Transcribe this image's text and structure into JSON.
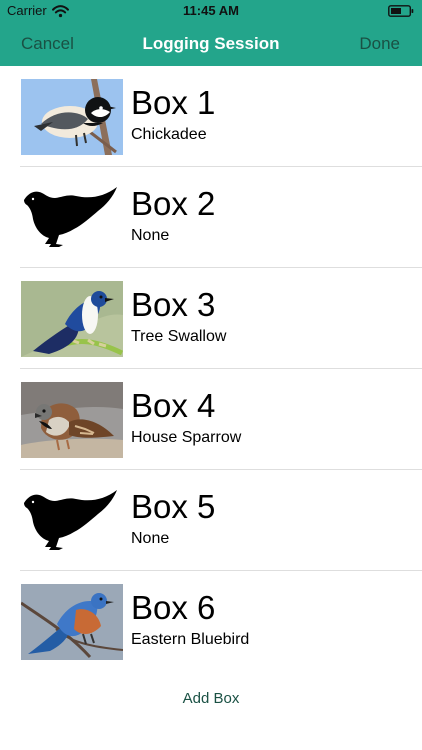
{
  "status_bar": {
    "carrier": "Carrier",
    "time": "11:45 AM",
    "icons": [
      "wifi-icon",
      "battery-icon"
    ]
  },
  "nav": {
    "left_button": "Cancel",
    "title": "Logging Session",
    "right_button": "Done",
    "colors": {
      "bar": "#23a58b",
      "title": "#ffffff",
      "buttons": "#1a5144"
    }
  },
  "boxes": [
    {
      "title": "Box 1",
      "subtitle": "Chickadee",
      "image": "chickadee-photo"
    },
    {
      "title": "Box 2",
      "subtitle": "None",
      "image": "bird-silhouette-icon"
    },
    {
      "title": "Box 3",
      "subtitle": "Tree Swallow",
      "image": "tree-swallow-photo"
    },
    {
      "title": "Box 4",
      "subtitle": "House Sparrow",
      "image": "house-sparrow-photo"
    },
    {
      "title": "Box 5",
      "subtitle": "None",
      "image": "bird-silhouette-icon"
    },
    {
      "title": "Box 6",
      "subtitle": "Eastern Bluebird",
      "image": "eastern-bluebird-photo"
    }
  ],
  "actions": {
    "add_box": "Add Box"
  }
}
